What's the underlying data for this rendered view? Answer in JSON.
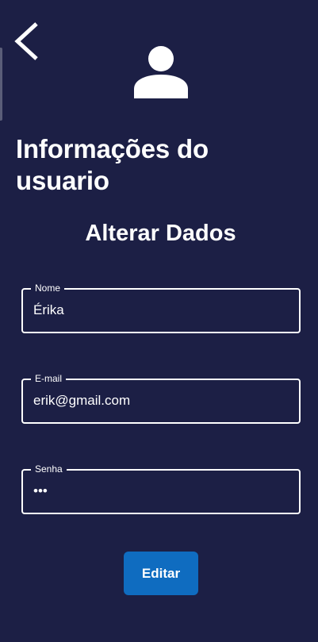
{
  "header": {
    "back_icon": "chevron-left-icon",
    "avatar_icon": "user-icon",
    "title": "Informações do usuario"
  },
  "form": {
    "section_title": "Alterar Dados",
    "fields": [
      {
        "label": "Nome",
        "value": "Érika"
      },
      {
        "label": "E-mail",
        "value": "erik@gmail.com"
      },
      {
        "label": "Senha",
        "value": "•••"
      }
    ],
    "submit_label": "Editar"
  },
  "colors": {
    "background": "#1c1f45",
    "button": "#0f6cc0",
    "text": "#ffffff"
  }
}
